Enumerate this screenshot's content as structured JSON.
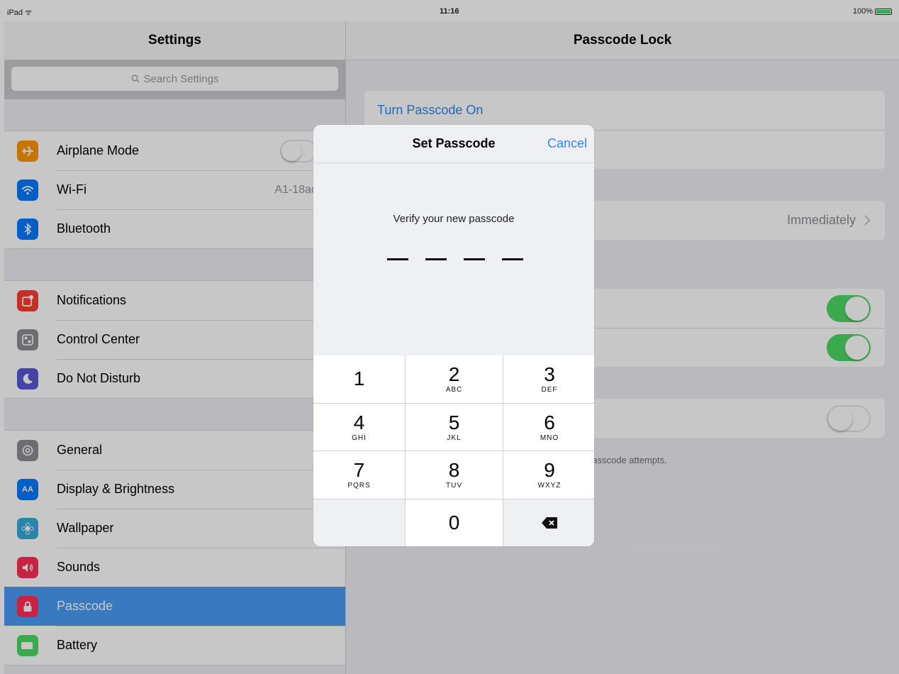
{
  "status_bar": {
    "left": "iPad ᯤ",
    "time": "11:16",
    "battery": "100%"
  },
  "left_panel": {
    "title": "Settings",
    "search_placeholder": "Search Settings",
    "groups": [
      [
        {
          "label": "Airplane Mode",
          "icon": "airplane-icon",
          "color": "#ff9500",
          "value": "",
          "toggle": true
        },
        {
          "label": "Wi-Fi",
          "icon": "wifi-icon",
          "color": "#007aff",
          "value": "A1-18ac"
        },
        {
          "label": "Bluetooth",
          "icon": "bluetooth-icon",
          "color": "#007aff",
          "value": ""
        }
      ],
      [
        {
          "label": "Notifications",
          "icon": "notifications-icon",
          "color": "#ff3b30"
        },
        {
          "label": "Control Center",
          "icon": "control-center-icon",
          "color": "#8e8e93"
        },
        {
          "label": "Do Not Disturb",
          "icon": "moon-icon",
          "color": "#5856d6"
        }
      ],
      [
        {
          "label": "General",
          "icon": "gear-icon",
          "color": "#8e8e93"
        },
        {
          "label": "Display & Brightness",
          "icon": "display-icon",
          "color": "#007aff"
        },
        {
          "label": "Wallpaper",
          "icon": "wallpaper-icon",
          "color": "#34aadc"
        },
        {
          "label": "Sounds",
          "icon": "speaker-icon",
          "color": "#ff2d55"
        },
        {
          "label": "Passcode",
          "icon": "lock-icon",
          "color": "#ff2d55",
          "selected": true
        },
        {
          "label": "Battery",
          "icon": "battery-icon",
          "color": "#4cd964"
        }
      ]
    ]
  },
  "right_panel": {
    "title": "Passcode Lock",
    "turn_on_label": "Turn Passcode On",
    "require_value": "Immediately",
    "footnote": "passcode attempts."
  },
  "modal": {
    "title": "Set Passcode",
    "cancel_label": "Cancel",
    "prompt": "Verify your new passcode",
    "keys": [
      {
        "num": "1",
        "letters": ""
      },
      {
        "num": "2",
        "letters": "ABC"
      },
      {
        "num": "3",
        "letters": "DEF"
      },
      {
        "num": "4",
        "letters": "GHI"
      },
      {
        "num": "5",
        "letters": "JKL"
      },
      {
        "num": "6",
        "letters": "MNO"
      },
      {
        "num": "7",
        "letters": "PQRS"
      },
      {
        "num": "8",
        "letters": "TUV"
      },
      {
        "num": "9",
        "letters": "WXYZ"
      },
      {
        "num": "0",
        "letters": ""
      }
    ]
  },
  "colors": {
    "accent": "#2f86f6",
    "toggle_on": "#4cd964",
    "selected_row": "#4a9cf7"
  }
}
